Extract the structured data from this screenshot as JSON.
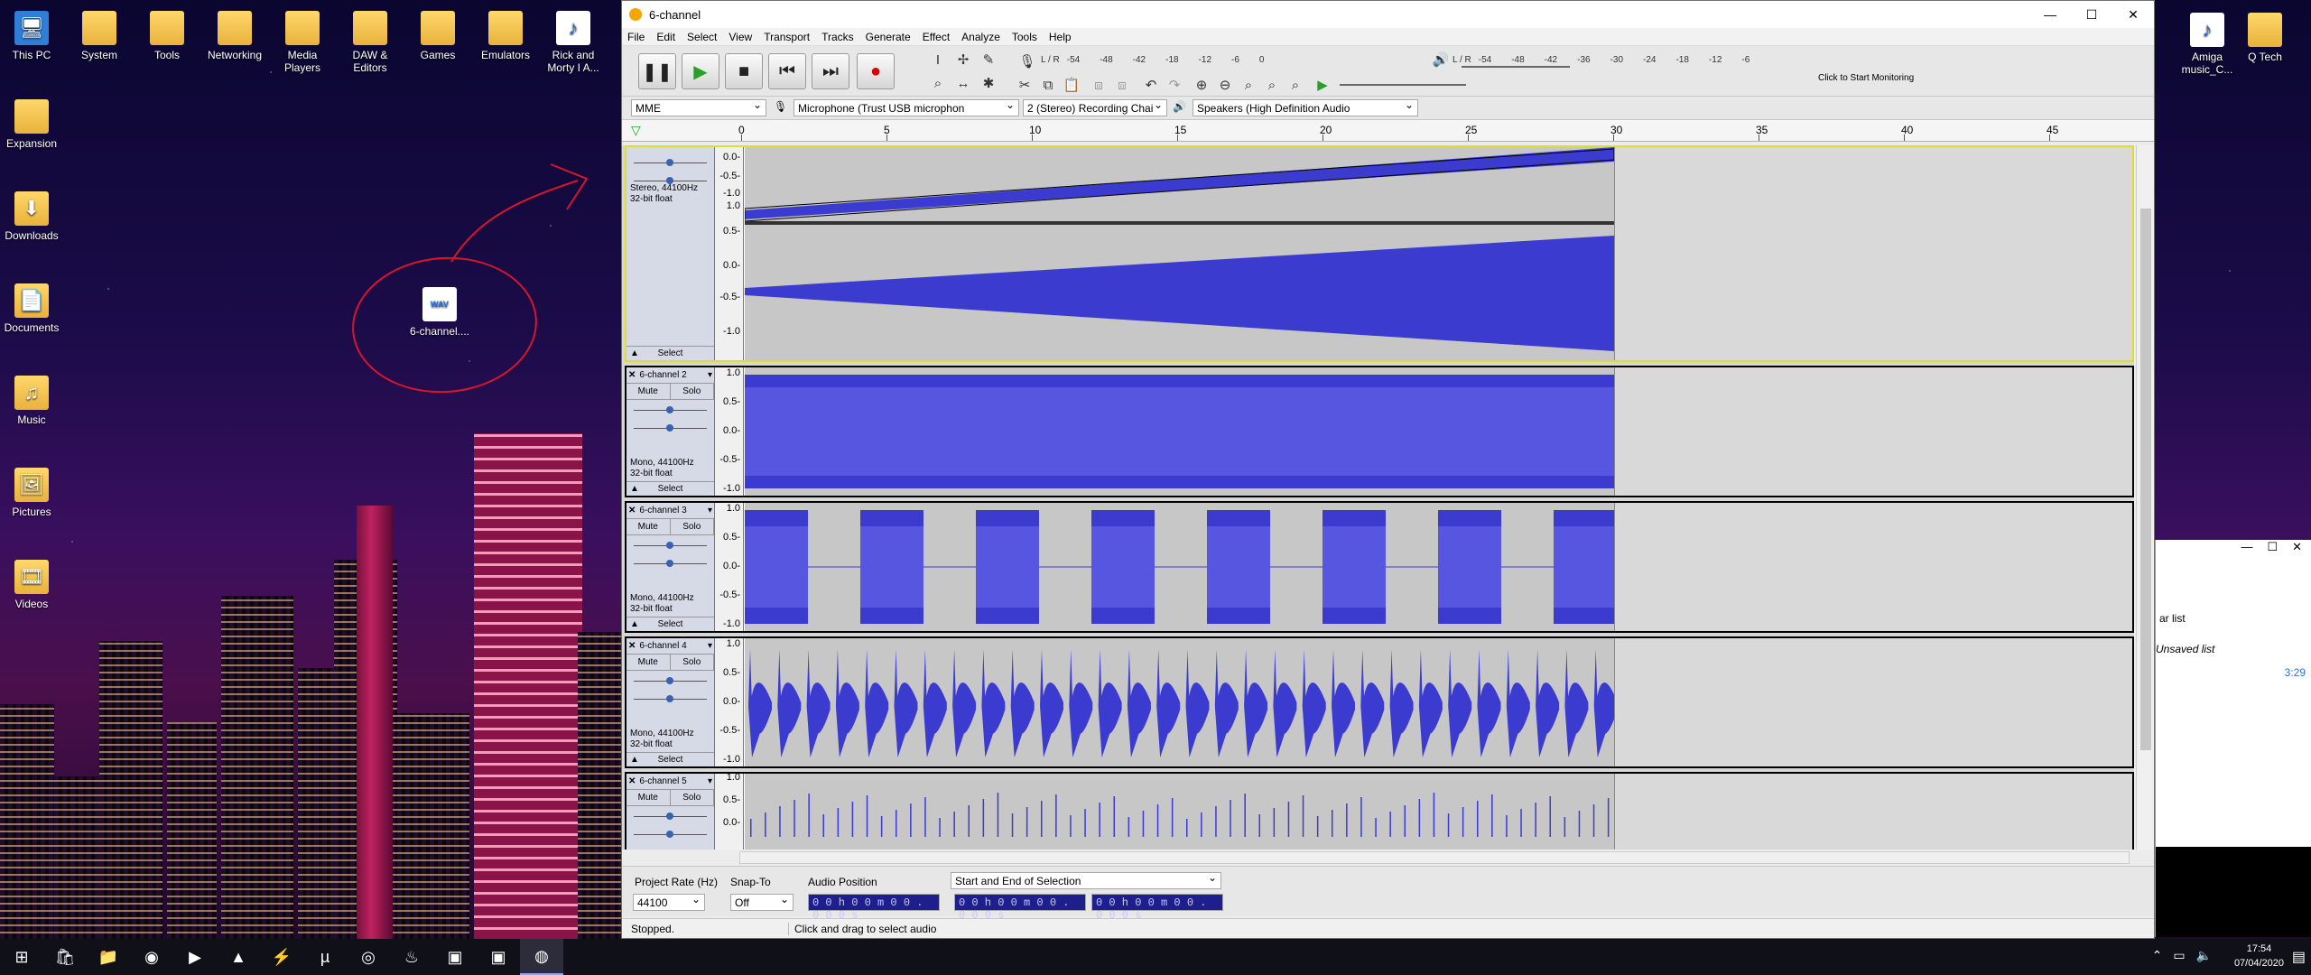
{
  "desktop": {
    "icons_left": [
      {
        "label": "This PC",
        "icon": "computer-icon"
      },
      {
        "label": "System",
        "icon": "folder-icon"
      },
      {
        "label": "Tools",
        "icon": "folder-icon"
      },
      {
        "label": "Networking",
        "icon": "folder-icon"
      },
      {
        "label": "Media Players",
        "icon": "folder-icon"
      },
      {
        "label": "DAW & Editors",
        "icon": "folder-icon"
      },
      {
        "label": "Games",
        "icon": "folder-icon"
      },
      {
        "label": "Emulators",
        "icon": "folder-icon"
      },
      {
        "label": "Rick and Morty  I A...",
        "icon": "wav-icon"
      }
    ],
    "icons_column": [
      {
        "label": "Expansion",
        "icon": "folder-icon"
      },
      {
        "label": "Downloads",
        "icon": "downloads-icon"
      },
      {
        "label": "Documents",
        "icon": "documents-icon"
      },
      {
        "label": "Music",
        "icon": "music-icon"
      },
      {
        "label": "Pictures",
        "icon": "pictures-icon"
      },
      {
        "label": "Videos",
        "icon": "videos-icon"
      }
    ],
    "icons_right": [
      {
        "label": "Amiga music_C...",
        "icon": "wav-icon"
      },
      {
        "label": "Q Tech",
        "icon": "folder-icon"
      }
    ],
    "circled_file": {
      "label": "6-channel....",
      "icon": "wav-icon",
      "badge": "WAV"
    },
    "annotation_color": "#d8162a"
  },
  "audacity": {
    "title": "6-channel",
    "menus": [
      "File",
      "Edit",
      "Select",
      "View",
      "Transport",
      "Tracks",
      "Generate",
      "Effect",
      "Analyze",
      "Tools",
      "Help"
    ],
    "meter": {
      "monitor_label": "Click to Start Monitoring",
      "rec_scale": [
        "-54",
        "-48",
        "-42",
        "-18",
        "-12",
        "-6",
        "0"
      ],
      "play_scale": [
        "-54",
        "-48",
        "-42",
        "-36",
        "-30",
        "-24",
        "-18",
        "-12",
        "-6"
      ],
      "L": "L",
      "R": "R"
    },
    "devices": {
      "host": "MME",
      "recording_device": "Microphone (Trust USB microphon",
      "channels": "2 (Stereo) Recording Chai",
      "playback_device": "Speakers (High Definition Audio"
    },
    "ruler_ticks": [
      "0",
      "5",
      "10",
      "15",
      "20",
      "25",
      "30",
      "35",
      "40",
      "45"
    ],
    "tracks": [
      {
        "name": "",
        "format_line1": "Stereo, 44100Hz",
        "format_line2": "32-bit float",
        "select_label": "Select",
        "channels": 2,
        "scale": [
          "0.0-",
          "-0.5-",
          "-1.0",
          "1.0",
          "0.5-",
          "0.0-",
          "-0.5-",
          "-1.0"
        ]
      },
      {
        "name": "6-channel 2",
        "mute": "Mute",
        "solo": "Solo",
        "format_line1": "Mono, 44100Hz",
        "format_line2": "32-bit float",
        "select_label": "Select",
        "scale": [
          "1.0",
          "0.5-",
          "0.0-",
          "-0.5-",
          "-1.0"
        ]
      },
      {
        "name": "6-channel 3",
        "mute": "Mute",
        "solo": "Solo",
        "format_line1": "Mono, 44100Hz",
        "format_line2": "32-bit float",
        "select_label": "Select",
        "scale": [
          "1.0",
          "0.5-",
          "0.0-",
          "-0.5-",
          "-1.0"
        ]
      },
      {
        "name": "6-channel 4",
        "mute": "Mute",
        "solo": "Solo",
        "format_line1": "Mono, 44100Hz",
        "format_line2": "32-bit float",
        "select_label": "Select",
        "scale": [
          "1.0",
          "0.5-",
          "0.0-",
          "-0.5-",
          "-1.0"
        ]
      },
      {
        "name": "6-channel 5",
        "mute": "Mute",
        "solo": "Solo",
        "scale": [
          "1.0",
          "0.5-",
          "0.0-"
        ]
      }
    ],
    "wave_color": "#3b3bd0",
    "selection_toolbar": {
      "project_rate_label": "Project Rate (Hz)",
      "project_rate": "44100",
      "snap_label": "Snap-To",
      "snap_value": "Off",
      "audio_position_label": "Audio Position",
      "audio_position": "0 0 h 0 0 m 0 0 . 0 0 0 s",
      "selection_label": "Start and End of Selection",
      "selection_start": "0 0 h 0 0 m 0 0 . 0 0 0 s",
      "selection_end": "0 0 h 0 0 m 0 0 . 0 0 0 s"
    },
    "status_left": "Stopped.",
    "status_right": "Click and drag to select audio"
  },
  "right_window": {
    "text1": "ar list",
    "text2": "Unsaved list",
    "time": "3:29"
  },
  "taskbar": {
    "icons": [
      "windows-start-icon",
      "store-icon",
      "file-explorer-icon",
      "firefox-icon",
      "media-icon",
      "vlc-icon",
      "winamp-icon",
      "utorrent-icon",
      "record-icon",
      "steam-icon",
      "app-icon",
      "app-icon",
      "audacity-icon"
    ],
    "time": "17:54",
    "date": "07/04/2020"
  }
}
